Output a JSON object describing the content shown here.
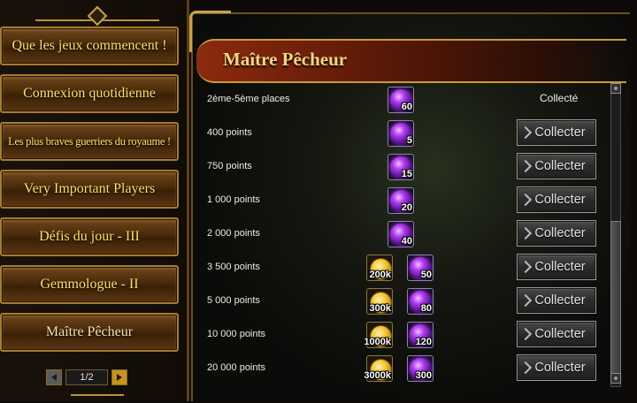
{
  "sidebar": {
    "items": [
      {
        "label": "Que les jeux commencent !"
      },
      {
        "label": "Connexion quotidienne"
      },
      {
        "label": "Les plus braves guerriers du royaume !"
      },
      {
        "label": "Very Important Players"
      },
      {
        "label": "Défis du jour - III"
      },
      {
        "label": "Gemmologue - II"
      },
      {
        "label": "Maître Pêcheur"
      }
    ],
    "pager": {
      "label": "1/2"
    }
  },
  "main": {
    "title": "Maître Pêcheur",
    "collected_label": "Collecté",
    "collect_label": "Collecter",
    "rows": [
      {
        "label": "2ème-5ème places",
        "rewards": [
          {
            "icon": "purple-orb-icon",
            "qty": "60"
          }
        ],
        "status": "collected"
      },
      {
        "label": "400 points",
        "rewards": [
          {
            "icon": "purple-orb-icon",
            "qty": "5"
          }
        ],
        "status": "collect"
      },
      {
        "label": "750 points",
        "rewards": [
          {
            "icon": "purple-orb-icon",
            "qty": "15"
          }
        ],
        "status": "collect"
      },
      {
        "label": "1 000 points",
        "rewards": [
          {
            "icon": "purple-orb-icon",
            "qty": "20"
          }
        ],
        "status": "collect"
      },
      {
        "label": "2 000 points",
        "rewards": [
          {
            "icon": "purple-orb-icon",
            "qty": "40"
          }
        ],
        "status": "collect"
      },
      {
        "label": "3 500 points",
        "rewards": [
          {
            "icon": "gold-coin-icon",
            "qty": "200k"
          },
          {
            "icon": "purple-orb-icon",
            "qty": "50"
          }
        ],
        "status": "collect"
      },
      {
        "label": "5 000 points",
        "rewards": [
          {
            "icon": "gold-coin-icon",
            "qty": "300k"
          },
          {
            "icon": "purple-orb-icon",
            "qty": "80"
          }
        ],
        "status": "collect"
      },
      {
        "label": "10 000 points",
        "rewards": [
          {
            "icon": "gold-coin-icon",
            "qty": "1000k"
          },
          {
            "icon": "purple-orb-icon",
            "qty": "120"
          }
        ],
        "status": "collect"
      },
      {
        "label": "20 000 points",
        "rewards": [
          {
            "icon": "gold-coin-icon",
            "qty": "3000k"
          },
          {
            "icon": "purple-orb-icon",
            "qty": "300"
          }
        ],
        "status": "collect"
      }
    ]
  }
}
